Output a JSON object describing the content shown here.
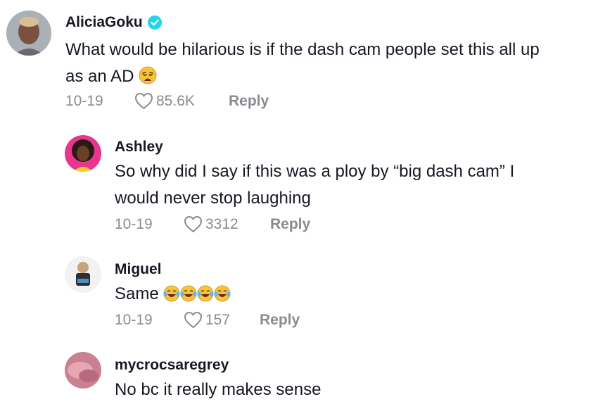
{
  "comments": [
    {
      "username": "AliciaGoku",
      "verified": true,
      "text_line1": "What would be hilarious is if the dash cam people set this all up",
      "text_line2": "as an AD",
      "emoji": "weary-face",
      "date": "10-19",
      "likes": "85.6K",
      "reply_label": "Reply"
    },
    {
      "username": "Ashley",
      "text_line1": "So why did I say if this was a ploy by “big dash cam” I",
      "text_line2": "would never stop laughing",
      "date": "10-19",
      "likes": "3312",
      "reply_label": "Reply"
    },
    {
      "username": "Miguel",
      "text_line1": "Same",
      "emoji": "laughing-crying-face x4",
      "date": "10-19",
      "likes": "157",
      "reply_label": "Reply"
    },
    {
      "username": "mycrocsaregrey",
      "text_line1": "No bc it really makes sense"
    }
  ],
  "colors": {
    "text": "#161823",
    "meta": "#8a8b91",
    "verified": "#20d5ec"
  }
}
